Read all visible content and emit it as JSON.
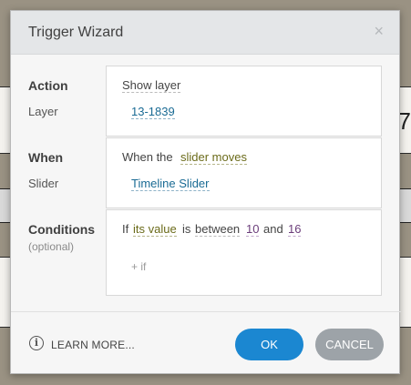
{
  "dialog": {
    "title": "Trigger Wizard",
    "close_glyph": "×"
  },
  "action": {
    "label": "Action",
    "sub_label": "Layer",
    "value": "Show layer",
    "layer": "13-1839"
  },
  "when": {
    "label": "When",
    "sub_label": "Slider",
    "prefix": "When the",
    "event": "slider moves",
    "slider": "Timeline Slider"
  },
  "conditions": {
    "label": "Conditions",
    "optional": "(optional)",
    "if": "If",
    "subject": "its value",
    "is": "is",
    "operator": "between",
    "low": "10",
    "and": "and",
    "high": "16",
    "add_if": "+ if"
  },
  "footer": {
    "info_glyph": "i",
    "learn_more": "LEARN MORE...",
    "ok": "OK",
    "cancel": "CANCEL"
  },
  "background": {
    "fragment": "7"
  },
  "icons": [
    "close-icon",
    "info-icon"
  ],
  "colors": {
    "primary": "#1b87d1",
    "secondary": "#9da3a8",
    "link": "#1a6b94",
    "event": "#6b6b1a",
    "number": "#6b3d7a"
  }
}
